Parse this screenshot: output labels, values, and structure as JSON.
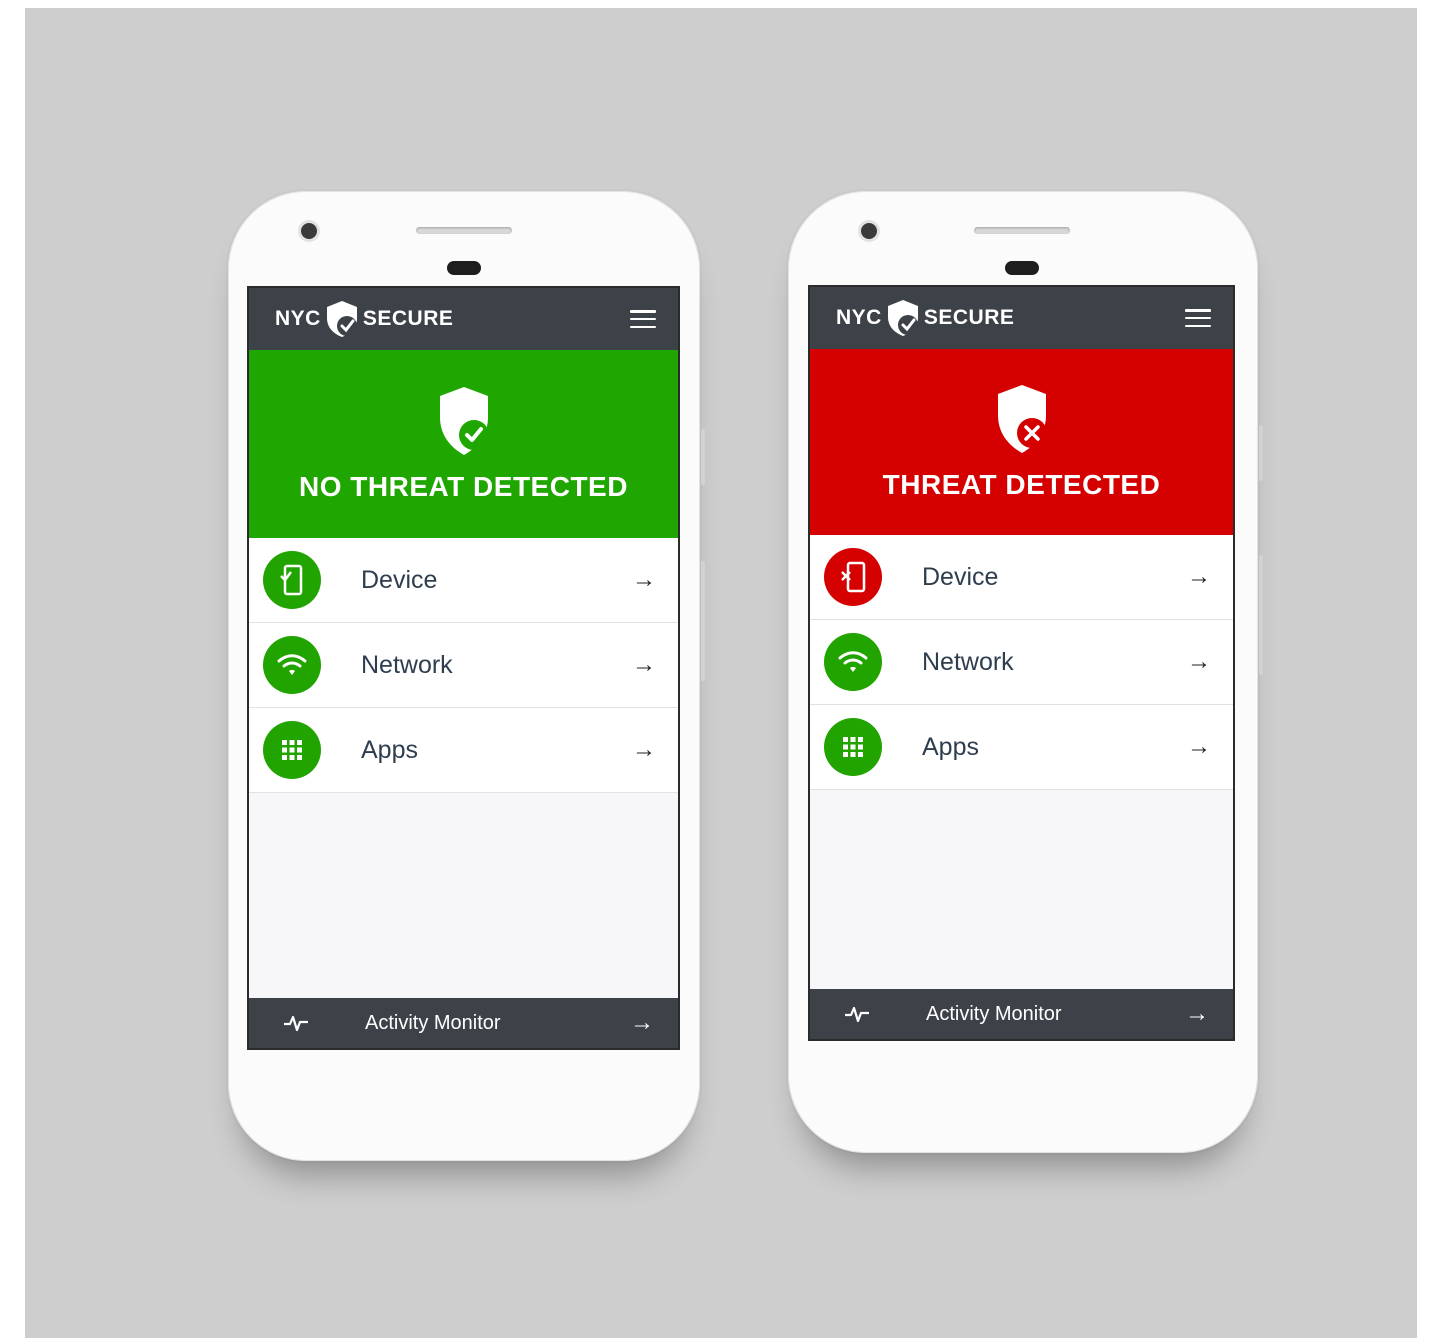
{
  "colors": {
    "safe": "#1fa600",
    "threat": "#d50000",
    "bar": "#3d4249",
    "background": "#cecece"
  },
  "phones": [
    {
      "app": {
        "logo_left": "NYC",
        "logo_right": "SECURE"
      },
      "status": {
        "title": "NO THREAT DETECTED",
        "state": "safe",
        "icon": "shield-check-icon"
      },
      "items": [
        {
          "label": "Device",
          "icon": "device-check-icon",
          "status": "safe",
          "arrow": "→"
        },
        {
          "label": "Network",
          "icon": "wifi-icon",
          "status": "safe",
          "arrow": "→"
        },
        {
          "label": "Apps",
          "icon": "apps-grid-icon",
          "status": "safe",
          "arrow": "→"
        }
      ],
      "footer": {
        "label": "Activity Monitor",
        "icon": "pulse-icon",
        "arrow": "→"
      }
    },
    {
      "app": {
        "logo_left": "NYC",
        "logo_right": "SECURE"
      },
      "status": {
        "title": "THREAT DETECTED",
        "state": "threat",
        "icon": "shield-x-icon"
      },
      "items": [
        {
          "label": "Device",
          "icon": "device-x-icon",
          "status": "threat",
          "arrow": "→"
        },
        {
          "label": "Network",
          "icon": "wifi-icon",
          "status": "safe",
          "arrow": "→"
        },
        {
          "label": "Apps",
          "icon": "apps-grid-icon",
          "status": "safe",
          "arrow": "→"
        }
      ],
      "footer": {
        "label": "Activity Monitor",
        "icon": "pulse-icon",
        "arrow": "→"
      }
    }
  ]
}
